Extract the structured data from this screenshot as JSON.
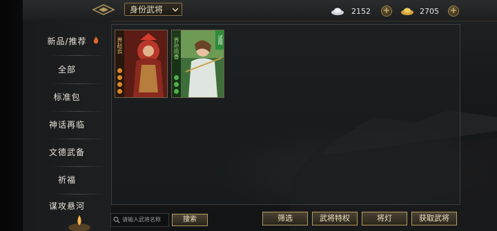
{
  "topbar": {
    "identity_filter": "身份武将",
    "silver_amount": "2152",
    "gold_amount": "2705",
    "plus": "+"
  },
  "sidebar": {
    "items": [
      {
        "label": "新品/推荐"
      },
      {
        "label": "全部"
      },
      {
        "label": "标准包"
      },
      {
        "label": "神话再临"
      },
      {
        "label": "文德武备"
      },
      {
        "label": "祈福"
      },
      {
        "label": "谋攻悬河"
      }
    ]
  },
  "cards": [
    {
      "name": "界赵云",
      "badge_color": "#c99a3a",
      "dot_color": "#d98a2a"
    },
    {
      "name": "界孙尚香",
      "badge_color": "#49a84a",
      "dot_color": "#55b04c",
      "trial": "试用"
    }
  ],
  "bottombar": {
    "search_placeholder": "请输入武将名称",
    "search_button": "搜索",
    "filter_button": "筛选",
    "privilege_button": "武将特权",
    "lantern_button": "将灯",
    "obtain_button": "获取武将"
  },
  "colors": {
    "accent_gold": "#b59a5e",
    "text_light": "#e6e2d8"
  }
}
